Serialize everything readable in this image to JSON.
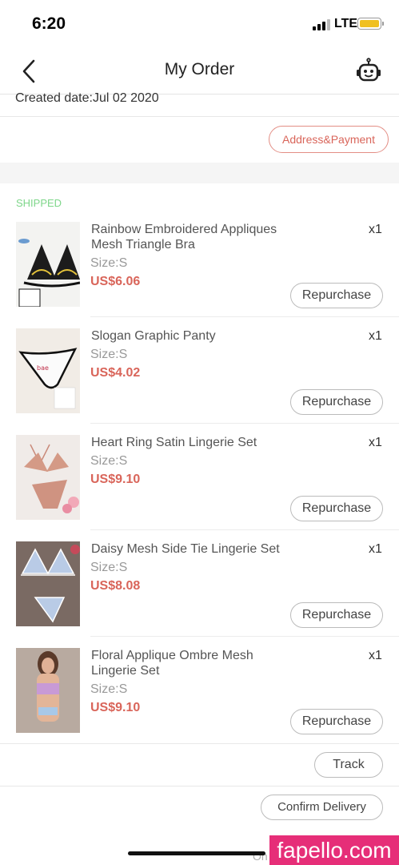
{
  "status_bar": {
    "time": "6:20",
    "network": "LTE",
    "battery_color": "#f0c020"
  },
  "header": {
    "title": "My Order",
    "back_icon": "chevron-left-icon",
    "support_icon": "robot-icon"
  },
  "order": {
    "created_date": "Created date:Jul 02 2020",
    "address_payment_label": "Address&Payment",
    "status": "SHIPPED"
  },
  "items": [
    {
      "name": "Rainbow Embroidered Appliques Mesh Triangle Bra",
      "size": "Size:S",
      "price": "US$6.06",
      "qty": "x1",
      "action": "Repurchase"
    },
    {
      "name": "Slogan Graphic Panty",
      "size": "Size:S",
      "price": "US$4.02",
      "qty": "x1",
      "action": "Repurchase"
    },
    {
      "name": "Heart Ring Satin Lingerie Set",
      "size": "Size:S",
      "price": "US$9.10",
      "qty": "x1",
      "action": "Repurchase"
    },
    {
      "name": "Daisy Mesh Side Tie Lingerie Set",
      "size": "Size:S",
      "price": "US$8.08",
      "qty": "x1",
      "action": "Repurchase"
    },
    {
      "name": "Floral Applique Ombre Mesh Lingerie Set",
      "size": "Size:S",
      "price": "US$9.10",
      "qty": "x1",
      "action": "Repurchase"
    }
  ],
  "actions": {
    "track_label": "Track",
    "confirm_label": "Confirm Delivery"
  },
  "footer": {
    "partial_text": "On",
    "watermark": "fapello.com"
  },
  "colors": {
    "accent": "#d9655a",
    "shipped": "#7ed68a",
    "watermark_bg": "#e62e78"
  }
}
